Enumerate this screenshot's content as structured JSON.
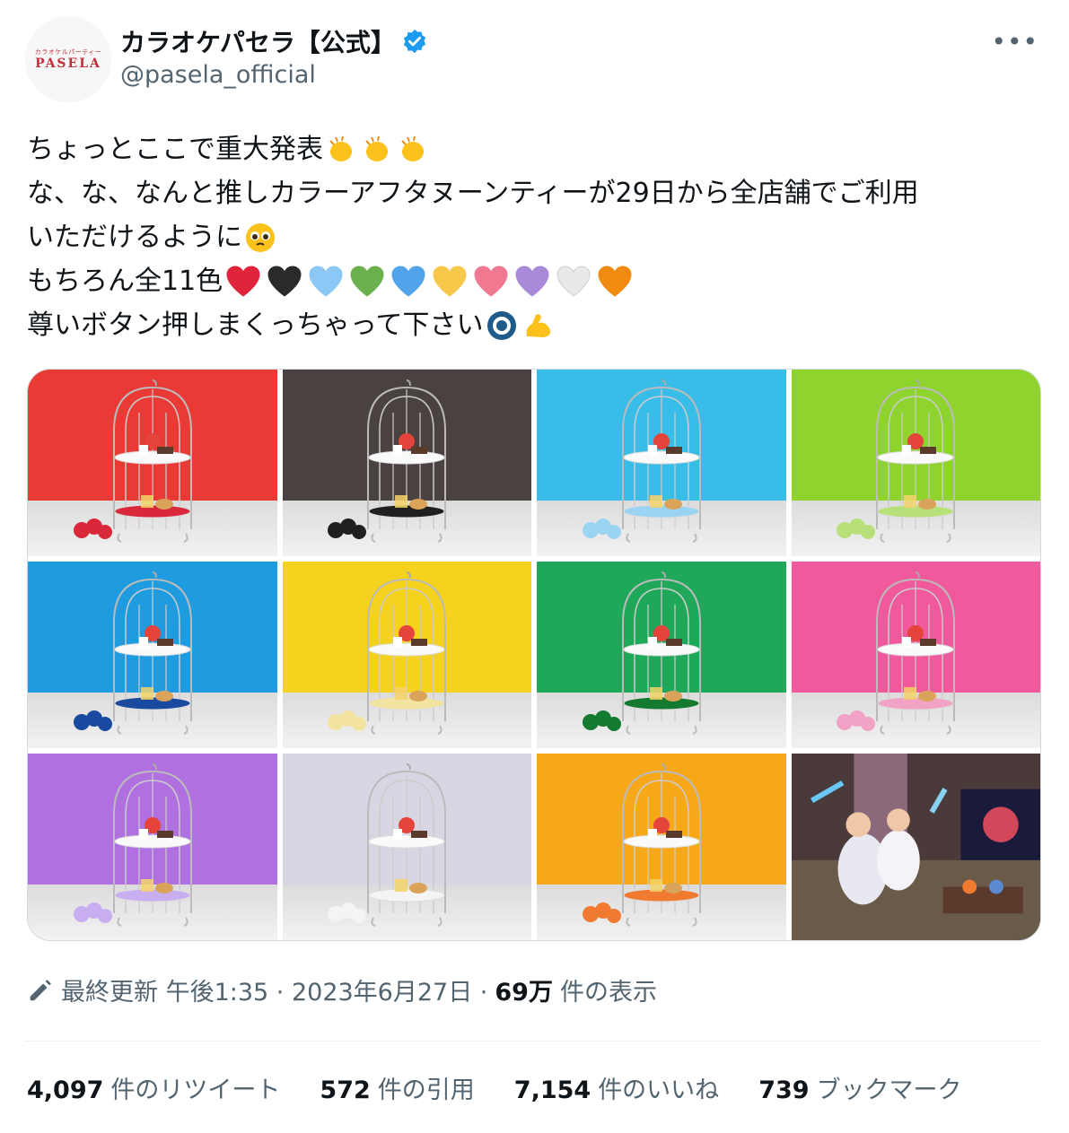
{
  "account": {
    "avatar_small": "カラオケルパーティー",
    "avatar_big": "PASELA",
    "display_name": "カラオケパセラ【公式】",
    "handle": "@pasela_official"
  },
  "tweet": {
    "line1": "ちょっとここで重大発表",
    "line2": "な、な、なんと推しカラーアフタヌーンティーが29日から全店舗でご利用",
    "line3": "いただけるように",
    "line4": "もちろん全11色",
    "line5": "尊いボタン押しまくっちゃって下さい"
  },
  "hearts": [
    "#e0243c",
    "#2a2a2a",
    "#8cc8f5",
    "#6ab04c",
    "#52a4ea",
    "#f7c84a",
    "#f07890",
    "#a98ad8",
    "#e8e8e8",
    "#f08a10"
  ],
  "photos": [
    {
      "bg": "#ea3a35",
      "accent": "#d8283a"
    },
    {
      "bg": "#4a4240",
      "accent": "#202020"
    },
    {
      "bg": "#38bde8",
      "accent": "#9ad4f2"
    },
    {
      "bg": "#8fd42e",
      "accent": "#b8e07a"
    },
    {
      "bg": "#1f9be0",
      "accent": "#1a4aa0"
    },
    {
      "bg": "#f5d21e",
      "accent": "#f3e3a0"
    },
    {
      "bg": "#1fa85a",
      "accent": "#147a30"
    },
    {
      "bg": "#f05a9c",
      "accent": "#f2a2c4"
    },
    {
      "bg": "#b070e0",
      "accent": "#c8aef0"
    },
    {
      "bg": "#d9d6e4",
      "accent": "#f4f4f4"
    },
    {
      "bg": "#f7a818",
      "accent": "#f07a30"
    }
  ],
  "meta": {
    "updated": "最終更新 午後1:35 · 2023年6月27日 ·",
    "views": "69万",
    "views_label": "件の表示"
  },
  "stats": {
    "retweets": "4,097",
    "retweets_label": "件のリツイート",
    "quotes": "572",
    "quotes_label": "件の引用",
    "likes": "7,154",
    "likes_label": "件のいいね",
    "bookmarks": "739",
    "bookmarks_label": "ブックマーク"
  }
}
